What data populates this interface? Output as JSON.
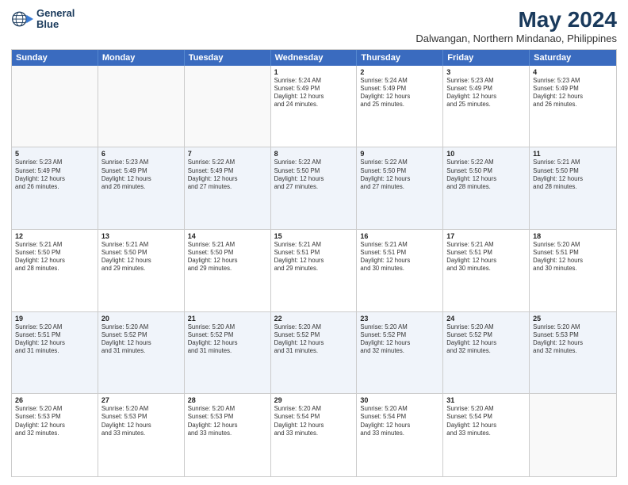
{
  "header": {
    "logo_line1": "General",
    "logo_line2": "Blue",
    "title": "May 2024",
    "subtitle": "Dalwangan, Northern Mindanao, Philippines"
  },
  "day_headers": [
    "Sunday",
    "Monday",
    "Tuesday",
    "Wednesday",
    "Thursday",
    "Friday",
    "Saturday"
  ],
  "weeks": [
    {
      "alt": false,
      "days": [
        {
          "num": "",
          "info": ""
        },
        {
          "num": "",
          "info": ""
        },
        {
          "num": "",
          "info": ""
        },
        {
          "num": "1",
          "info": "Sunrise: 5:24 AM\nSunset: 5:49 PM\nDaylight: 12 hours\nand 24 minutes."
        },
        {
          "num": "2",
          "info": "Sunrise: 5:24 AM\nSunset: 5:49 PM\nDaylight: 12 hours\nand 25 minutes."
        },
        {
          "num": "3",
          "info": "Sunrise: 5:23 AM\nSunset: 5:49 PM\nDaylight: 12 hours\nand 25 minutes."
        },
        {
          "num": "4",
          "info": "Sunrise: 5:23 AM\nSunset: 5:49 PM\nDaylight: 12 hours\nand 26 minutes."
        }
      ]
    },
    {
      "alt": true,
      "days": [
        {
          "num": "5",
          "info": "Sunrise: 5:23 AM\nSunset: 5:49 PM\nDaylight: 12 hours\nand 26 minutes."
        },
        {
          "num": "6",
          "info": "Sunrise: 5:23 AM\nSunset: 5:49 PM\nDaylight: 12 hours\nand 26 minutes."
        },
        {
          "num": "7",
          "info": "Sunrise: 5:22 AM\nSunset: 5:49 PM\nDaylight: 12 hours\nand 27 minutes."
        },
        {
          "num": "8",
          "info": "Sunrise: 5:22 AM\nSunset: 5:50 PM\nDaylight: 12 hours\nand 27 minutes."
        },
        {
          "num": "9",
          "info": "Sunrise: 5:22 AM\nSunset: 5:50 PM\nDaylight: 12 hours\nand 27 minutes."
        },
        {
          "num": "10",
          "info": "Sunrise: 5:22 AM\nSunset: 5:50 PM\nDaylight: 12 hours\nand 28 minutes."
        },
        {
          "num": "11",
          "info": "Sunrise: 5:21 AM\nSunset: 5:50 PM\nDaylight: 12 hours\nand 28 minutes."
        }
      ]
    },
    {
      "alt": false,
      "days": [
        {
          "num": "12",
          "info": "Sunrise: 5:21 AM\nSunset: 5:50 PM\nDaylight: 12 hours\nand 28 minutes."
        },
        {
          "num": "13",
          "info": "Sunrise: 5:21 AM\nSunset: 5:50 PM\nDaylight: 12 hours\nand 29 minutes."
        },
        {
          "num": "14",
          "info": "Sunrise: 5:21 AM\nSunset: 5:50 PM\nDaylight: 12 hours\nand 29 minutes."
        },
        {
          "num": "15",
          "info": "Sunrise: 5:21 AM\nSunset: 5:51 PM\nDaylight: 12 hours\nand 29 minutes."
        },
        {
          "num": "16",
          "info": "Sunrise: 5:21 AM\nSunset: 5:51 PM\nDaylight: 12 hours\nand 30 minutes."
        },
        {
          "num": "17",
          "info": "Sunrise: 5:21 AM\nSunset: 5:51 PM\nDaylight: 12 hours\nand 30 minutes."
        },
        {
          "num": "18",
          "info": "Sunrise: 5:20 AM\nSunset: 5:51 PM\nDaylight: 12 hours\nand 30 minutes."
        }
      ]
    },
    {
      "alt": true,
      "days": [
        {
          "num": "19",
          "info": "Sunrise: 5:20 AM\nSunset: 5:51 PM\nDaylight: 12 hours\nand 31 minutes."
        },
        {
          "num": "20",
          "info": "Sunrise: 5:20 AM\nSunset: 5:52 PM\nDaylight: 12 hours\nand 31 minutes."
        },
        {
          "num": "21",
          "info": "Sunrise: 5:20 AM\nSunset: 5:52 PM\nDaylight: 12 hours\nand 31 minutes."
        },
        {
          "num": "22",
          "info": "Sunrise: 5:20 AM\nSunset: 5:52 PM\nDaylight: 12 hours\nand 31 minutes."
        },
        {
          "num": "23",
          "info": "Sunrise: 5:20 AM\nSunset: 5:52 PM\nDaylight: 12 hours\nand 32 minutes."
        },
        {
          "num": "24",
          "info": "Sunrise: 5:20 AM\nSunset: 5:52 PM\nDaylight: 12 hours\nand 32 minutes."
        },
        {
          "num": "25",
          "info": "Sunrise: 5:20 AM\nSunset: 5:53 PM\nDaylight: 12 hours\nand 32 minutes."
        }
      ]
    },
    {
      "alt": false,
      "days": [
        {
          "num": "26",
          "info": "Sunrise: 5:20 AM\nSunset: 5:53 PM\nDaylight: 12 hours\nand 32 minutes."
        },
        {
          "num": "27",
          "info": "Sunrise: 5:20 AM\nSunset: 5:53 PM\nDaylight: 12 hours\nand 33 minutes."
        },
        {
          "num": "28",
          "info": "Sunrise: 5:20 AM\nSunset: 5:53 PM\nDaylight: 12 hours\nand 33 minutes."
        },
        {
          "num": "29",
          "info": "Sunrise: 5:20 AM\nSunset: 5:54 PM\nDaylight: 12 hours\nand 33 minutes."
        },
        {
          "num": "30",
          "info": "Sunrise: 5:20 AM\nSunset: 5:54 PM\nDaylight: 12 hours\nand 33 minutes."
        },
        {
          "num": "31",
          "info": "Sunrise: 5:20 AM\nSunset: 5:54 PM\nDaylight: 12 hours\nand 33 minutes."
        },
        {
          "num": "",
          "info": ""
        }
      ]
    }
  ]
}
